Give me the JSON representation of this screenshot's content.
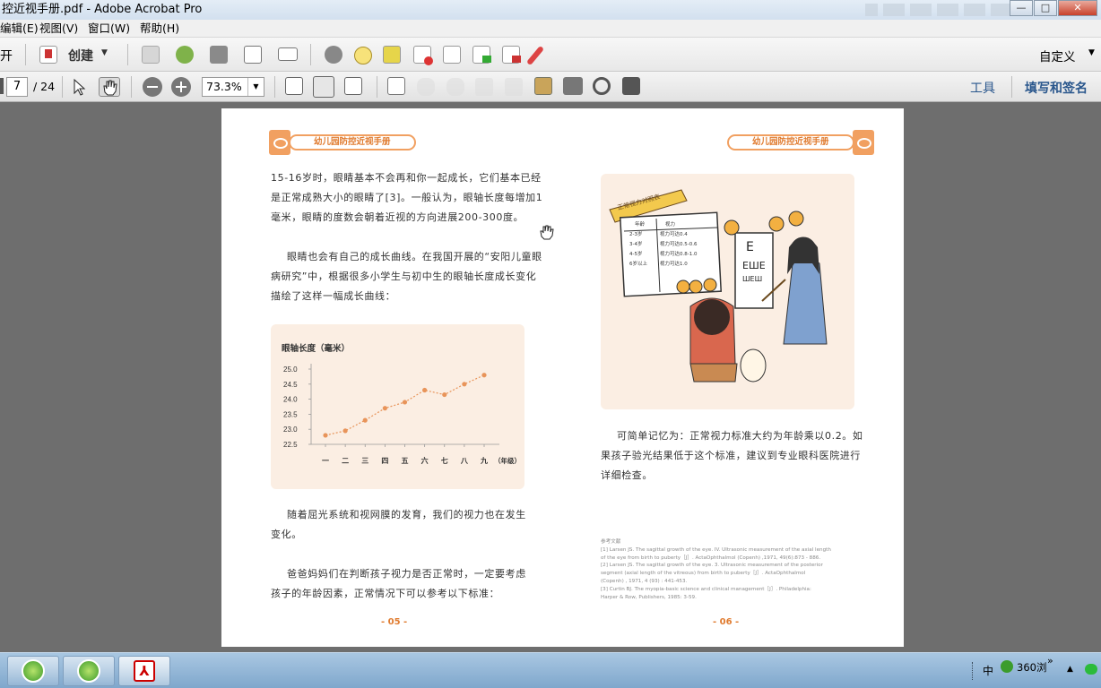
{
  "window": {
    "title": "控近视手册.pdf - Adobe Acrobat Pro",
    "min": "—",
    "max": "□",
    "close": "✕"
  },
  "menu": [
    "编辑(E)",
    "视图(V)",
    "窗口(W)",
    "帮助(H)"
  ],
  "toolbar": {
    "open_label": "开",
    "create_label": "创建",
    "custom_label": "自定义"
  },
  "nav": {
    "page": "7",
    "total": "/ 24",
    "zoom": "73.3%",
    "tools": "工具",
    "sign": "填写和签名"
  },
  "left_page": {
    "header": "幼儿园防控近视手册",
    "para1": [
      "15-16岁时，眼睛基本不会再和你一起成长，它们基本已经",
      "是正常成熟大小的眼睛了[3]。一般认为，眼轴长度每增加1",
      "毫米，眼睛的度数会朝着近视的方向进展200-300度。"
    ],
    "para2": [
      "眼睛也会有自己的成长曲线。在我国开展的“安阳儿童眼",
      "病研究”中，根据很多小学生与初中生的眼轴长度成长变化",
      "描绘了这样一幅成长曲线："
    ],
    "para3": [
      "随着屈光系统和视网膜的发育，我们的视力也在发生",
      "变化。"
    ],
    "para4": [
      "爸爸妈妈们在判断孩子视力是否正常时，一定要考虑",
      "孩子的年龄因素，正常情况下可以参考以下标准："
    ],
    "page_number": "- 05 -"
  },
  "chart_data": {
    "type": "line",
    "title": "眼轴长度（毫米）",
    "categories": [
      "一",
      "二",
      "三",
      "四",
      "五",
      "六",
      "七",
      "八",
      "九"
    ],
    "x_unit": "（年级）",
    "series": [
      {
        "values": [
          22.8,
          22.95,
          23.3,
          23.7,
          23.9,
          24.3,
          24.15,
          24.5,
          24.8
        ]
      }
    ],
    "yticks": [
      "25.0",
      "24.5",
      "24.0",
      "23.5",
      "23.0",
      "22.5"
    ],
    "ylim": [
      22.5,
      25.0
    ],
    "color": "#e8945a"
  },
  "right_page": {
    "header": "幼儿园防控近视手册",
    "banner": "正常视力对照表",
    "table": {
      "headers": [
        "年龄",
        "视力"
      ],
      "rows": [
        [
          "2-3岁",
          "视力可达0.4"
        ],
        [
          "3-4岁",
          "视力可达0.5-0.6"
        ],
        [
          "4-5岁",
          "视力可达0.8-1.0"
        ],
        [
          "6岁以上",
          "视力可达1.0"
        ]
      ]
    },
    "para": [
      "可简单记忆为：正常视力标准大约为年龄乘以0.2。如",
      "果孩子验光结果低于这个标准，建议到专业眼科医院进行",
      "详细检查。"
    ],
    "refs_title": "参考文献",
    "refs": [
      "[1] Larsen JS. The sagittal growth of the eye. IV. Ultrasonic measurement of the axial length",
      "of the eye from birth to puberty［J］. ActaOphthalmol (Copenh) ,1971, 49(6):873 - 886.",
      "[2] Larsen JS. The sagittal growth of the eye. 3. Ultrasonic measurement of the posterior",
      "segment (axial length of the vitreous) from birth to puberty［J］. ActaOphthalmol",
      "(Copenh) , 1971, 4 (93) : 441-453.",
      "[3] Curtin BJ. The myopia-basic science and clinical management［J］. Philadelphia:",
      "Harper & Row, Publishers, 1985: 3-59."
    ],
    "page_number": "- 06 -"
  },
  "taskbar": {
    "ime": "中",
    "browser": "360浏",
    "more": "»"
  }
}
